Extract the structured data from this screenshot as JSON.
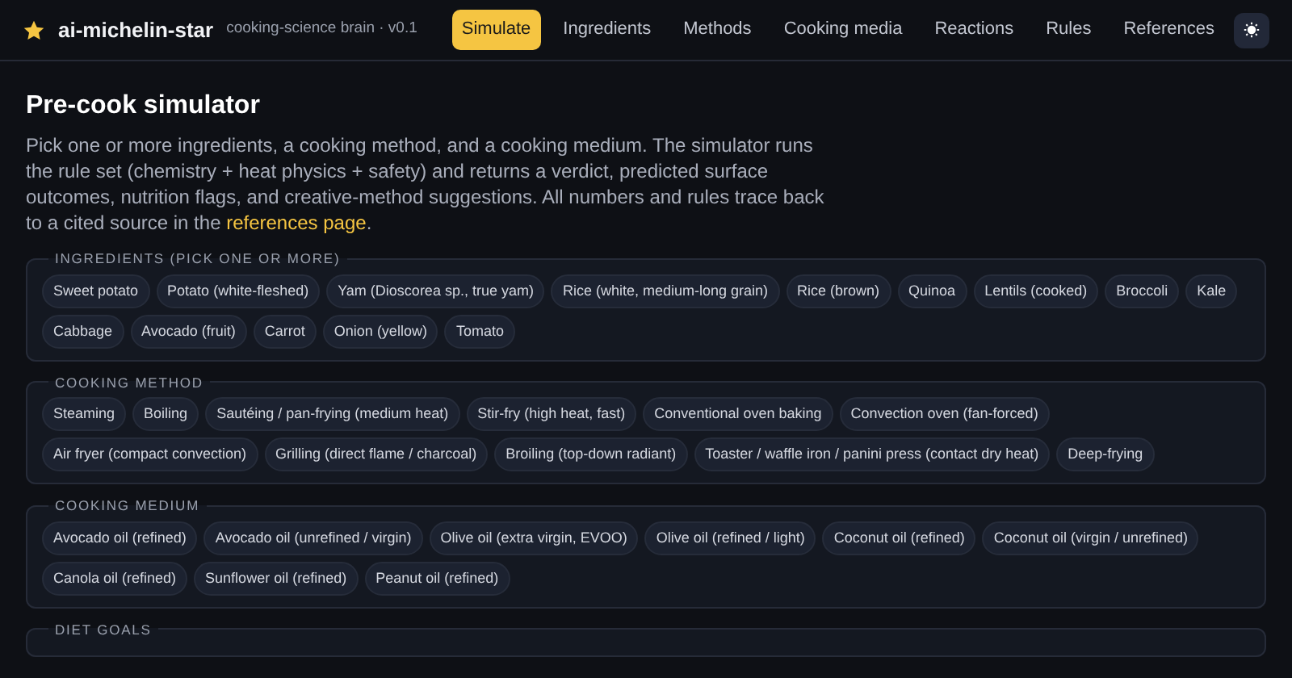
{
  "brand": {
    "name": "ai-michelin-star",
    "tagline": "cooking-science brain · v0.1"
  },
  "nav": [
    {
      "label": "Simulate",
      "selected": true
    },
    {
      "label": "Ingredients",
      "selected": false
    },
    {
      "label": "Methods",
      "selected": false
    },
    {
      "label": "Cooking media",
      "selected": false
    },
    {
      "label": "Reactions",
      "selected": false
    },
    {
      "label": "Rules",
      "selected": false
    },
    {
      "label": "References",
      "selected": false
    }
  ],
  "page": {
    "title": "Pre-cook simulator",
    "intro": "Pick one or more ingredients, a cooking method, and a cooking medium. The simulator runs the rule set (chemistry + heat physics + safety) and returns a verdict, predicted surface outcomes, nutrition flags, and creative-method suggestions. All numbers and rules trace back to a cited source in the ",
    "link": "references page",
    "intro_end": "."
  },
  "groups": [
    {
      "legend": "INGREDIENTS (PICK ONE OR MORE)",
      "options": [
        {
          "label": "Sweet potato",
          "selected": false
        },
        {
          "label": "Potato (white-fleshed)",
          "selected": false
        },
        {
          "label": "Yam (Dioscorea sp., true yam)",
          "selected": false
        },
        {
          "label": "Rice (white, medium-long grain)",
          "selected": false
        },
        {
          "label": "Rice (brown)",
          "selected": false
        },
        {
          "label": "Quinoa",
          "selected": false
        },
        {
          "label": "Lentils (cooked)",
          "selected": false
        },
        {
          "label": "Broccoli",
          "selected": false
        },
        {
          "label": "Kale",
          "selected": false
        },
        {
          "label": "Cabbage",
          "selected": false
        },
        {
          "label": "Avocado (fruit)",
          "selected": false
        },
        {
          "label": "Carrot",
          "selected": false
        },
        {
          "label": "Onion (yellow)",
          "selected": false
        },
        {
          "label": "Tomato",
          "selected": false
        }
      ]
    },
    {
      "legend": "COOKING METHOD",
      "options": [
        {
          "label": "Steaming",
          "selected": false
        },
        {
          "label": "Boiling",
          "selected": false
        },
        {
          "label": "Sautéing / pan-frying (medium heat)",
          "selected": false
        },
        {
          "label": "Stir-fry (high heat, fast)",
          "selected": false
        },
        {
          "label": "Conventional oven baking",
          "selected": false
        },
        {
          "label": "Convection oven (fan-forced)",
          "selected": false
        },
        {
          "label": "Air fryer (compact convection)",
          "selected": false
        },
        {
          "label": "Grilling (direct flame / charcoal)",
          "selected": false
        },
        {
          "label": "Broiling (top-down radiant)",
          "selected": false
        },
        {
          "label": "Toaster / waffle iron / panini press (contact dry heat)",
          "selected": false
        },
        {
          "label": "Deep-frying",
          "selected": false
        }
      ]
    },
    {
      "legend": "COOKING MEDIUM",
      "options": [
        {
          "label": "Avocado oil (refined)",
          "selected": false
        },
        {
          "label": "Avocado oil (unrefined / virgin)",
          "selected": false
        },
        {
          "label": "Olive oil (extra virgin, EVOO)",
          "selected": false
        },
        {
          "label": "Olive oil (refined / light)",
          "selected": false
        },
        {
          "label": "Coconut oil (refined)",
          "selected": false
        },
        {
          "label": "Coconut oil (virgin / unrefined)",
          "selected": false
        },
        {
          "label": "Canola oil (refined)",
          "selected": false
        },
        {
          "label": "Sunflower oil (refined)",
          "selected": false
        },
        {
          "label": "Peanut oil (refined)",
          "selected": false
        }
      ]
    },
    {
      "legend": "DIET GOALS"
    }
  ]
}
